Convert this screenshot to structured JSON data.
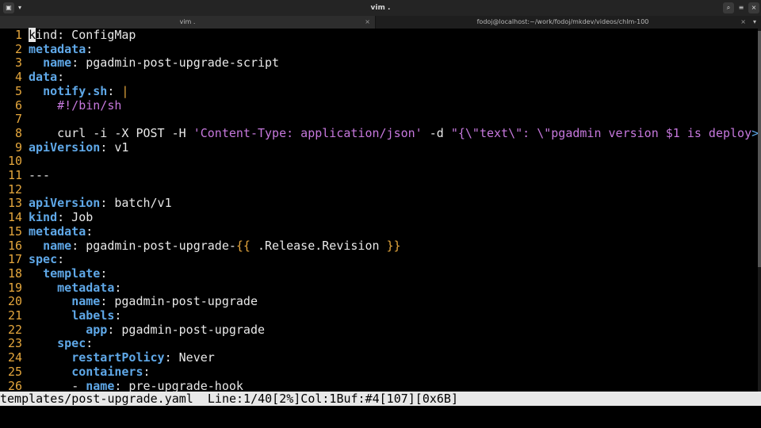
{
  "window": {
    "title": "vim .",
    "buttons": {
      "menu": "▣",
      "menu_caret": "▾",
      "search": "⌕",
      "options": "≡",
      "close": "×"
    }
  },
  "tabs": [
    {
      "label": "vim .",
      "close": "×",
      "active": true
    },
    {
      "label": "fodoj@localhost:~/work/fodoj/mkdev/videos/chlm-100",
      "close": "×",
      "active": false
    }
  ],
  "tab_menu": "▾",
  "editor": {
    "lines": [
      {
        "n": "1",
        "indent": "",
        "parts": [
          [
            "sel",
            "k"
          ],
          [
            "t",
            "ind: ConfigMap"
          ]
        ]
      },
      {
        "n": "2",
        "indent": "",
        "parts": [
          [
            "k",
            "metadata"
          ],
          [
            "t",
            ":"
          ]
        ]
      },
      {
        "n": "3",
        "indent": "  ",
        "parts": [
          [
            "k",
            "name"
          ],
          [
            "t",
            ": pgadmin-post-upgrade-script"
          ]
        ]
      },
      {
        "n": "4",
        "indent": "",
        "parts": [
          [
            "k",
            "data"
          ],
          [
            "t",
            ":"
          ]
        ]
      },
      {
        "n": "5",
        "indent": "  ",
        "parts": [
          [
            "k",
            "notify.sh"
          ],
          [
            "t",
            ": "
          ],
          [
            "pipe",
            "|"
          ]
        ]
      },
      {
        "n": "6",
        "indent": "    ",
        "parts": [
          [
            "s",
            "#!/bin/sh"
          ]
        ]
      },
      {
        "n": "7",
        "indent": "",
        "parts": []
      },
      {
        "n": "8",
        "indent": "    ",
        "parts": [
          [
            "t",
            "curl -i -X POST -H "
          ],
          [
            "s",
            "'Content-Type: application/json'"
          ],
          [
            "t",
            " -d "
          ],
          [
            "s",
            "\"{\\\"text\\\": \\\"pgadmin version $1 is deploy"
          ],
          [
            "trunc",
            ">"
          ]
        ]
      },
      {
        "n": "9",
        "indent": "",
        "parts": [
          [
            "k",
            "apiVersion"
          ],
          [
            "t",
            ": v1"
          ]
        ]
      },
      {
        "n": "10",
        "indent": "",
        "parts": []
      },
      {
        "n": "11",
        "indent": "",
        "parts": [
          [
            "t",
            "---"
          ]
        ]
      },
      {
        "n": "12",
        "indent": "",
        "parts": []
      },
      {
        "n": "13",
        "indent": "",
        "parts": [
          [
            "k",
            "apiVersion"
          ],
          [
            "t",
            ": batch/v1"
          ]
        ]
      },
      {
        "n": "14",
        "indent": "",
        "parts": [
          [
            "k",
            "kind"
          ],
          [
            "t",
            ": Job"
          ]
        ]
      },
      {
        "n": "15",
        "indent": "",
        "parts": [
          [
            "k",
            "metadata"
          ],
          [
            "t",
            ":"
          ]
        ]
      },
      {
        "n": "16",
        "indent": "  ",
        "parts": [
          [
            "k",
            "name"
          ],
          [
            "t",
            ": pgadmin-post-upgrade-"
          ],
          [
            "pipe",
            "{{"
          ],
          [
            "t",
            " .Release.Revision "
          ],
          [
            "pipe",
            "}}"
          ]
        ]
      },
      {
        "n": "17",
        "indent": "",
        "parts": [
          [
            "k",
            "spec"
          ],
          [
            "t",
            ":"
          ]
        ]
      },
      {
        "n": "18",
        "indent": "  ",
        "parts": [
          [
            "k",
            "template"
          ],
          [
            "t",
            ":"
          ]
        ]
      },
      {
        "n": "19",
        "indent": "    ",
        "parts": [
          [
            "k",
            "metadata"
          ],
          [
            "t",
            ":"
          ]
        ]
      },
      {
        "n": "20",
        "indent": "      ",
        "parts": [
          [
            "k",
            "name"
          ],
          [
            "t",
            ": pgadmin-post-upgrade"
          ]
        ]
      },
      {
        "n": "21",
        "indent": "      ",
        "parts": [
          [
            "k",
            "labels"
          ],
          [
            "t",
            ":"
          ]
        ]
      },
      {
        "n": "22",
        "indent": "        ",
        "parts": [
          [
            "k",
            "app"
          ],
          [
            "t",
            ": pgadmin-post-upgrade"
          ]
        ]
      },
      {
        "n": "23",
        "indent": "    ",
        "parts": [
          [
            "k",
            "spec"
          ],
          [
            "t",
            ":"
          ]
        ]
      },
      {
        "n": "24",
        "indent": "      ",
        "parts": [
          [
            "k",
            "restartPolicy"
          ],
          [
            "t",
            ": Never"
          ]
        ]
      },
      {
        "n": "25",
        "indent": "      ",
        "parts": [
          [
            "k",
            "containers"
          ],
          [
            "t",
            ":"
          ]
        ]
      },
      {
        "n": "26",
        "indent": "      ",
        "parts": [
          [
            "t",
            "- "
          ],
          [
            "k",
            "name"
          ],
          [
            "t",
            ": pre-upgrade-hook"
          ]
        ]
      }
    ]
  },
  "statusline": {
    "text": "templates/post-upgrade.yaml  Line:1/40[2%]Col:1Buf:#4[107][0x6B]"
  },
  "scroll": {
    "fraction_visible": 0.65,
    "position_percent": 2
  },
  "colors": {
    "line_number": "#e5a73d",
    "key": "#5fa8e8",
    "string": "#c678dd",
    "statusline_bg": "#e8e8e8"
  }
}
